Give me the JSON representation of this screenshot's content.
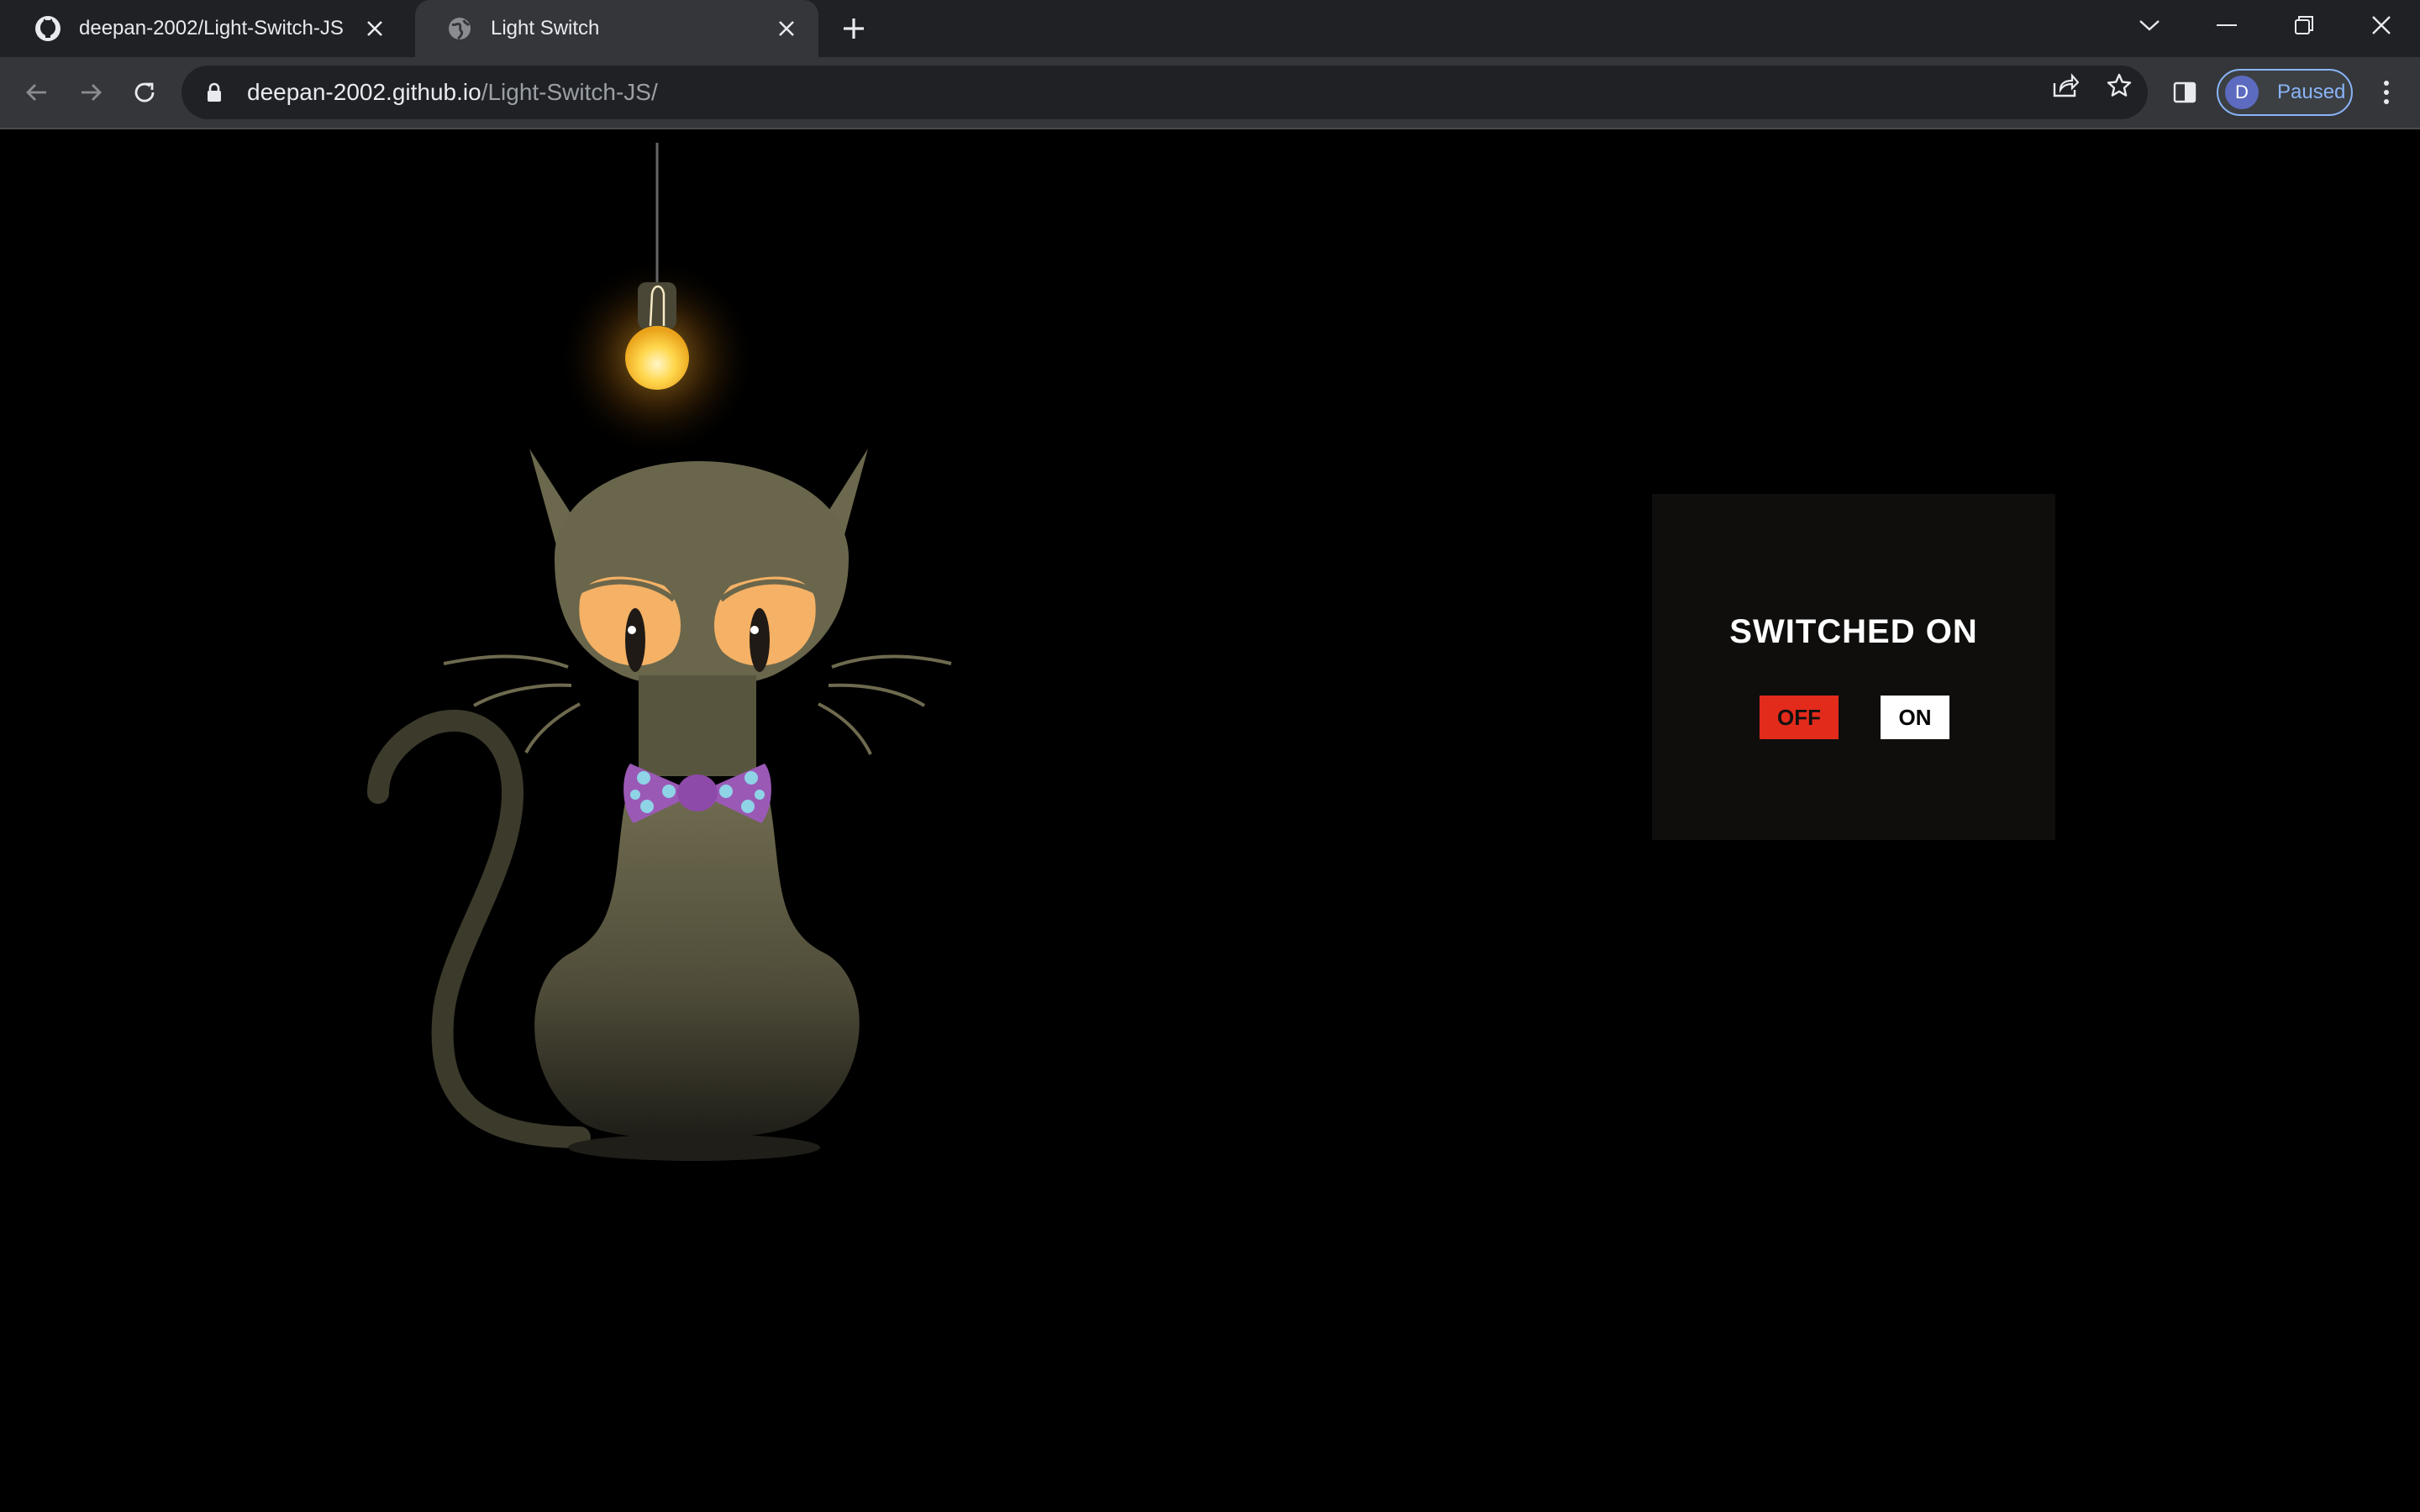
{
  "browser": {
    "tabs": [
      {
        "title": "deepan-2002/Light-Switch-JS",
        "favicon": "github-icon",
        "active": false
      },
      {
        "title": "Light Switch",
        "favicon": "globe-icon",
        "active": true
      }
    ],
    "url": {
      "host": "deepan-2002.github.io",
      "path": "/Light-Switch-JS/"
    },
    "profile": {
      "initial": "D",
      "status": "Paused"
    }
  },
  "page": {
    "status_text": "SWITCHED ON",
    "off_label": "OFF",
    "on_label": "ON",
    "colors": {
      "background": "#000000",
      "panel": "#0f0e0d",
      "off_button": "#e32b1b",
      "on_button": "#ffffff",
      "bulb": "#ffd24a",
      "cat_body": "#66624a",
      "cat_eyes": "#f5b165",
      "bowtie": "#9b59b6",
      "bowtie_dots": "#8fd3e6"
    }
  }
}
